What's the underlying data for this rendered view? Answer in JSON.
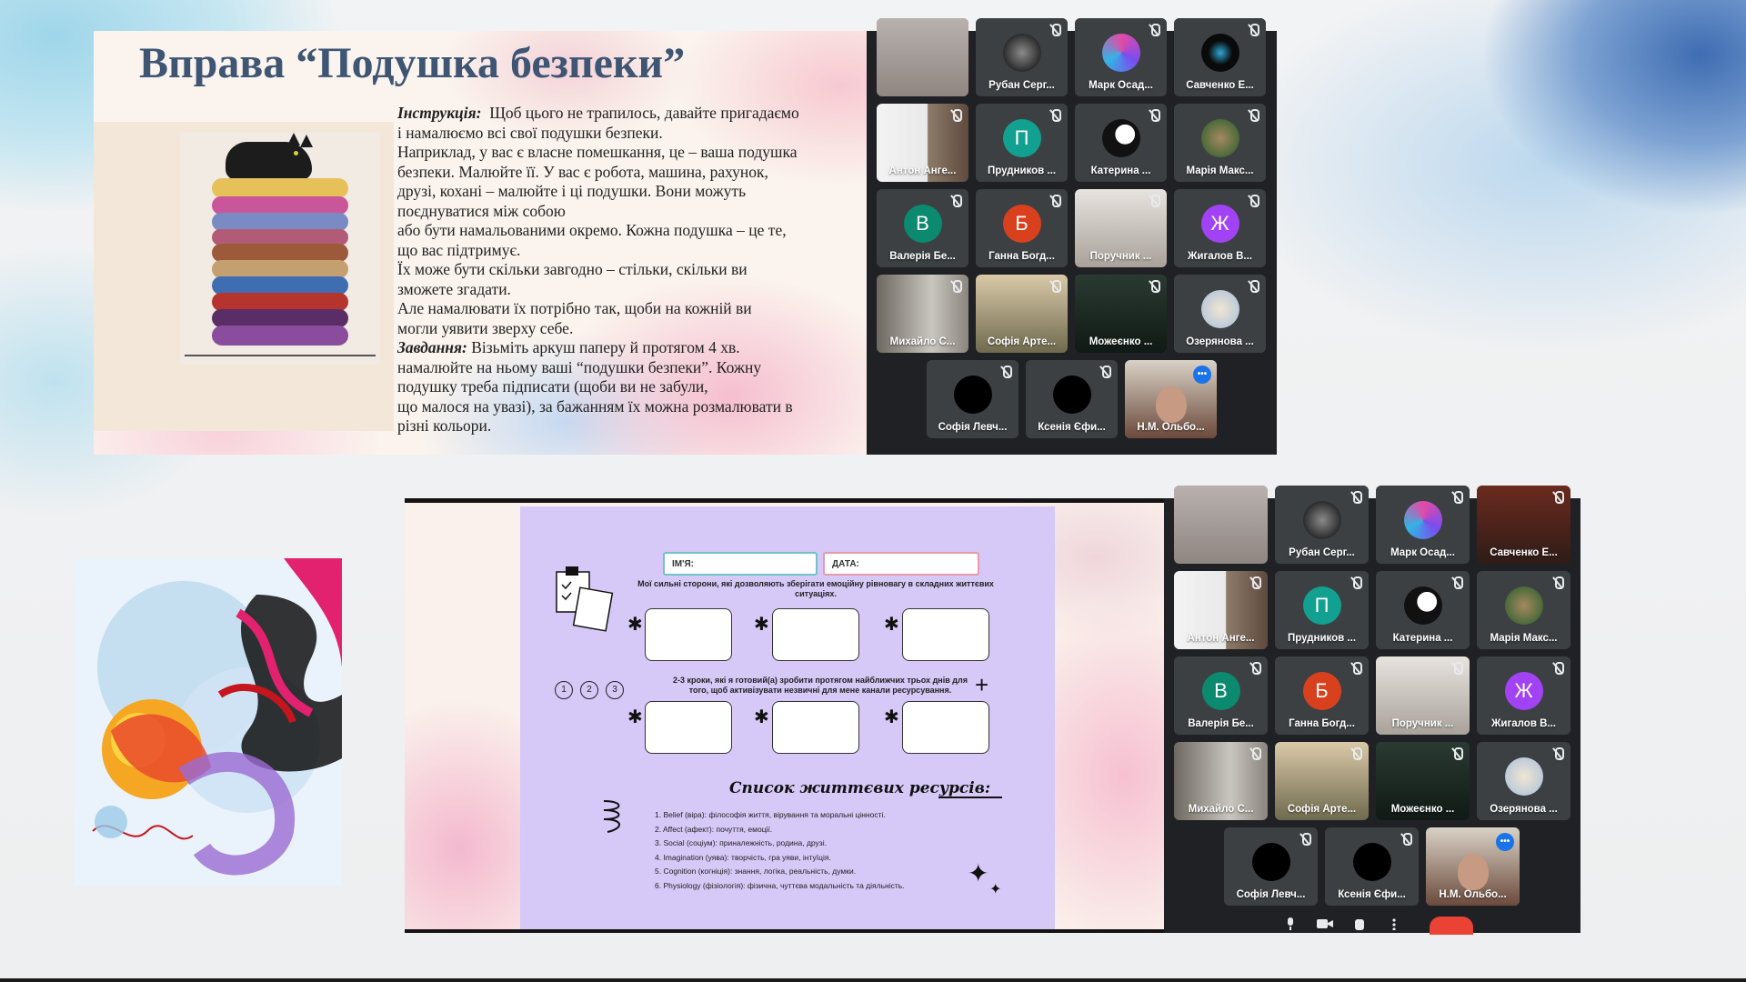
{
  "top_slide": {
    "title": "Вправа “Подушка безпеки”",
    "instruction_label": "Інструкція:",
    "instruction_text_1": "Щоб цього не трапилось, давайте пригадаємо",
    "lines": [
      "і  намалюємо всі свої  подушки безпеки.",
      "Наприклад, у вас є власне помешкання, це – ваша подушка",
      "безпеки. Малюйте її. У вас є робота, машина, рахунок,",
      "друзі, кохані – малюйте  і ці подушки. Вони можуть",
      "поєднуватися між собою",
      "або бути намальованими окремо. Кожна подушка – це те,",
      "що вас підтримує.",
      "Їх може бути скільки завгодно –  стільки, скільки ви",
      "зможете згадати.",
      " Але намалювати їх потрібно так, щоби на кожній ви",
      "могли уявити зверху себе."
    ],
    "task_label": "Завдання:",
    "task_text_1": "Візьміть аркуш паперу й протягом 4 хв.",
    "task_lines": [
      "намалюйте на ньому ваші “подушки  безпеки”. Кожну",
      "подушку треба підписати (щоби ви не забули,",
      "що малося на увазі), за бажанням їх можна розмалювати в",
      "різні кольори."
    ]
  },
  "grid1": {
    "tiles": [
      {
        "name": "",
        "kind": "screen"
      },
      {
        "name": "Рубан Серг...",
        "kind": "photo-dark"
      },
      {
        "name": "Марк Осад...",
        "kind": "photo-pink"
      },
      {
        "name": "Савченко Е...",
        "kind": "photo-black"
      },
      {
        "name": "Антон Анге...",
        "kind": "video-room"
      },
      {
        "name": "Прудников ...",
        "kind": "letter",
        "letter": "П",
        "color": "#12a090"
      },
      {
        "name": "Катерина ...",
        "kind": "photo-bw"
      },
      {
        "name": "Марія Макс...",
        "kind": "photo-green"
      },
      {
        "name": "Валерія Бе...",
        "kind": "letter",
        "letter": "В",
        "color": "#0b8a6f"
      },
      {
        "name": "Ганна Богд...",
        "kind": "letter",
        "letter": "Б",
        "color": "#d9411e"
      },
      {
        "name": "Поручник ...",
        "kind": "video-light"
      },
      {
        "name": "Жигалов В...",
        "kind": "letter",
        "letter": "Ж",
        "color": "#a142f4"
      },
      {
        "name": "Михайло С...",
        "kind": "video-shelf"
      },
      {
        "name": "Софія Арте...",
        "kind": "video-warm"
      },
      {
        "name": "Можеєнко ...",
        "kind": "video-dark"
      },
      {
        "name": "Озерянова ...",
        "kind": "photo-map"
      },
      {
        "name": "Софія Левч...",
        "kind": "black"
      },
      {
        "name": "Ксенія Єфи...",
        "kind": "black"
      },
      {
        "name": "Н.М. Ольбо...",
        "kind": "video-speaker",
        "speaking": true
      }
    ]
  },
  "grid2": {
    "tiles": [
      {
        "name": "",
        "kind": "screen"
      },
      {
        "name": "Рубан Серг...",
        "kind": "photo-dark"
      },
      {
        "name": "Марк Осад...",
        "kind": "photo-pink"
      },
      {
        "name": "Савченко Е...",
        "kind": "photo-red"
      },
      {
        "name": "Антон Анге...",
        "kind": "video-room"
      },
      {
        "name": "Прудников ...",
        "kind": "letter",
        "letter": "П",
        "color": "#12a090"
      },
      {
        "name": "Катерина ...",
        "kind": "photo-bw"
      },
      {
        "name": "Марія Макс...",
        "kind": "photo-green"
      },
      {
        "name": "Валерія Бе...",
        "kind": "letter",
        "letter": "В",
        "color": "#0b8a6f"
      },
      {
        "name": "Ганна Богд...",
        "kind": "letter",
        "letter": "Б",
        "color": "#d9411e"
      },
      {
        "name": "Поручник ...",
        "kind": "video-light"
      },
      {
        "name": "Жигалов В...",
        "kind": "letter",
        "letter": "Ж",
        "color": "#a142f4"
      },
      {
        "name": "Михайло С...",
        "kind": "video-shelf"
      },
      {
        "name": "Софія Арте...",
        "kind": "video-warm"
      },
      {
        "name": "Можеєнко ...",
        "kind": "video-dark"
      },
      {
        "name": "Озерянова ...",
        "kind": "photo-map"
      },
      {
        "name": "Софія Левч...",
        "kind": "black"
      },
      {
        "name": "Ксенія Єфи...",
        "kind": "black"
      },
      {
        "name": "Н.М. Ольбо...",
        "kind": "video-speaker",
        "speaking": true
      }
    ]
  },
  "worksheet": {
    "name_label": "ІМ'Я:",
    "date_label": "ДАТА:",
    "caption_1": "Мої сильні сторони, які дозволяють зберігати емоційну рівновагу в складних життєвих ситуаціях.",
    "caption_2": "2-3 кроки, які я готовий(а) зробити протягом найближчих трьох днів для того, щоб активізувати незвичні для мене канали ресурсування.",
    "steps": [
      "1",
      "2",
      "3"
    ],
    "list_title": "Список життєвих ресурсів:",
    "list": [
      "1. Belief (віра): філософія життя, вірування та моральні цінності.",
      "2. Affect (афект): почуття, емоції.",
      "3. Social (соціум): приналежність, родина, друзі.",
      "4. Imagination (уява): творчість, гра уяви, інтуїція.",
      "5. Cognition (когніція): знання, логіка, реальність, думки.",
      "6. Physiology (фізіологія): фізична, чуттєва модальність та діяльність."
    ]
  }
}
